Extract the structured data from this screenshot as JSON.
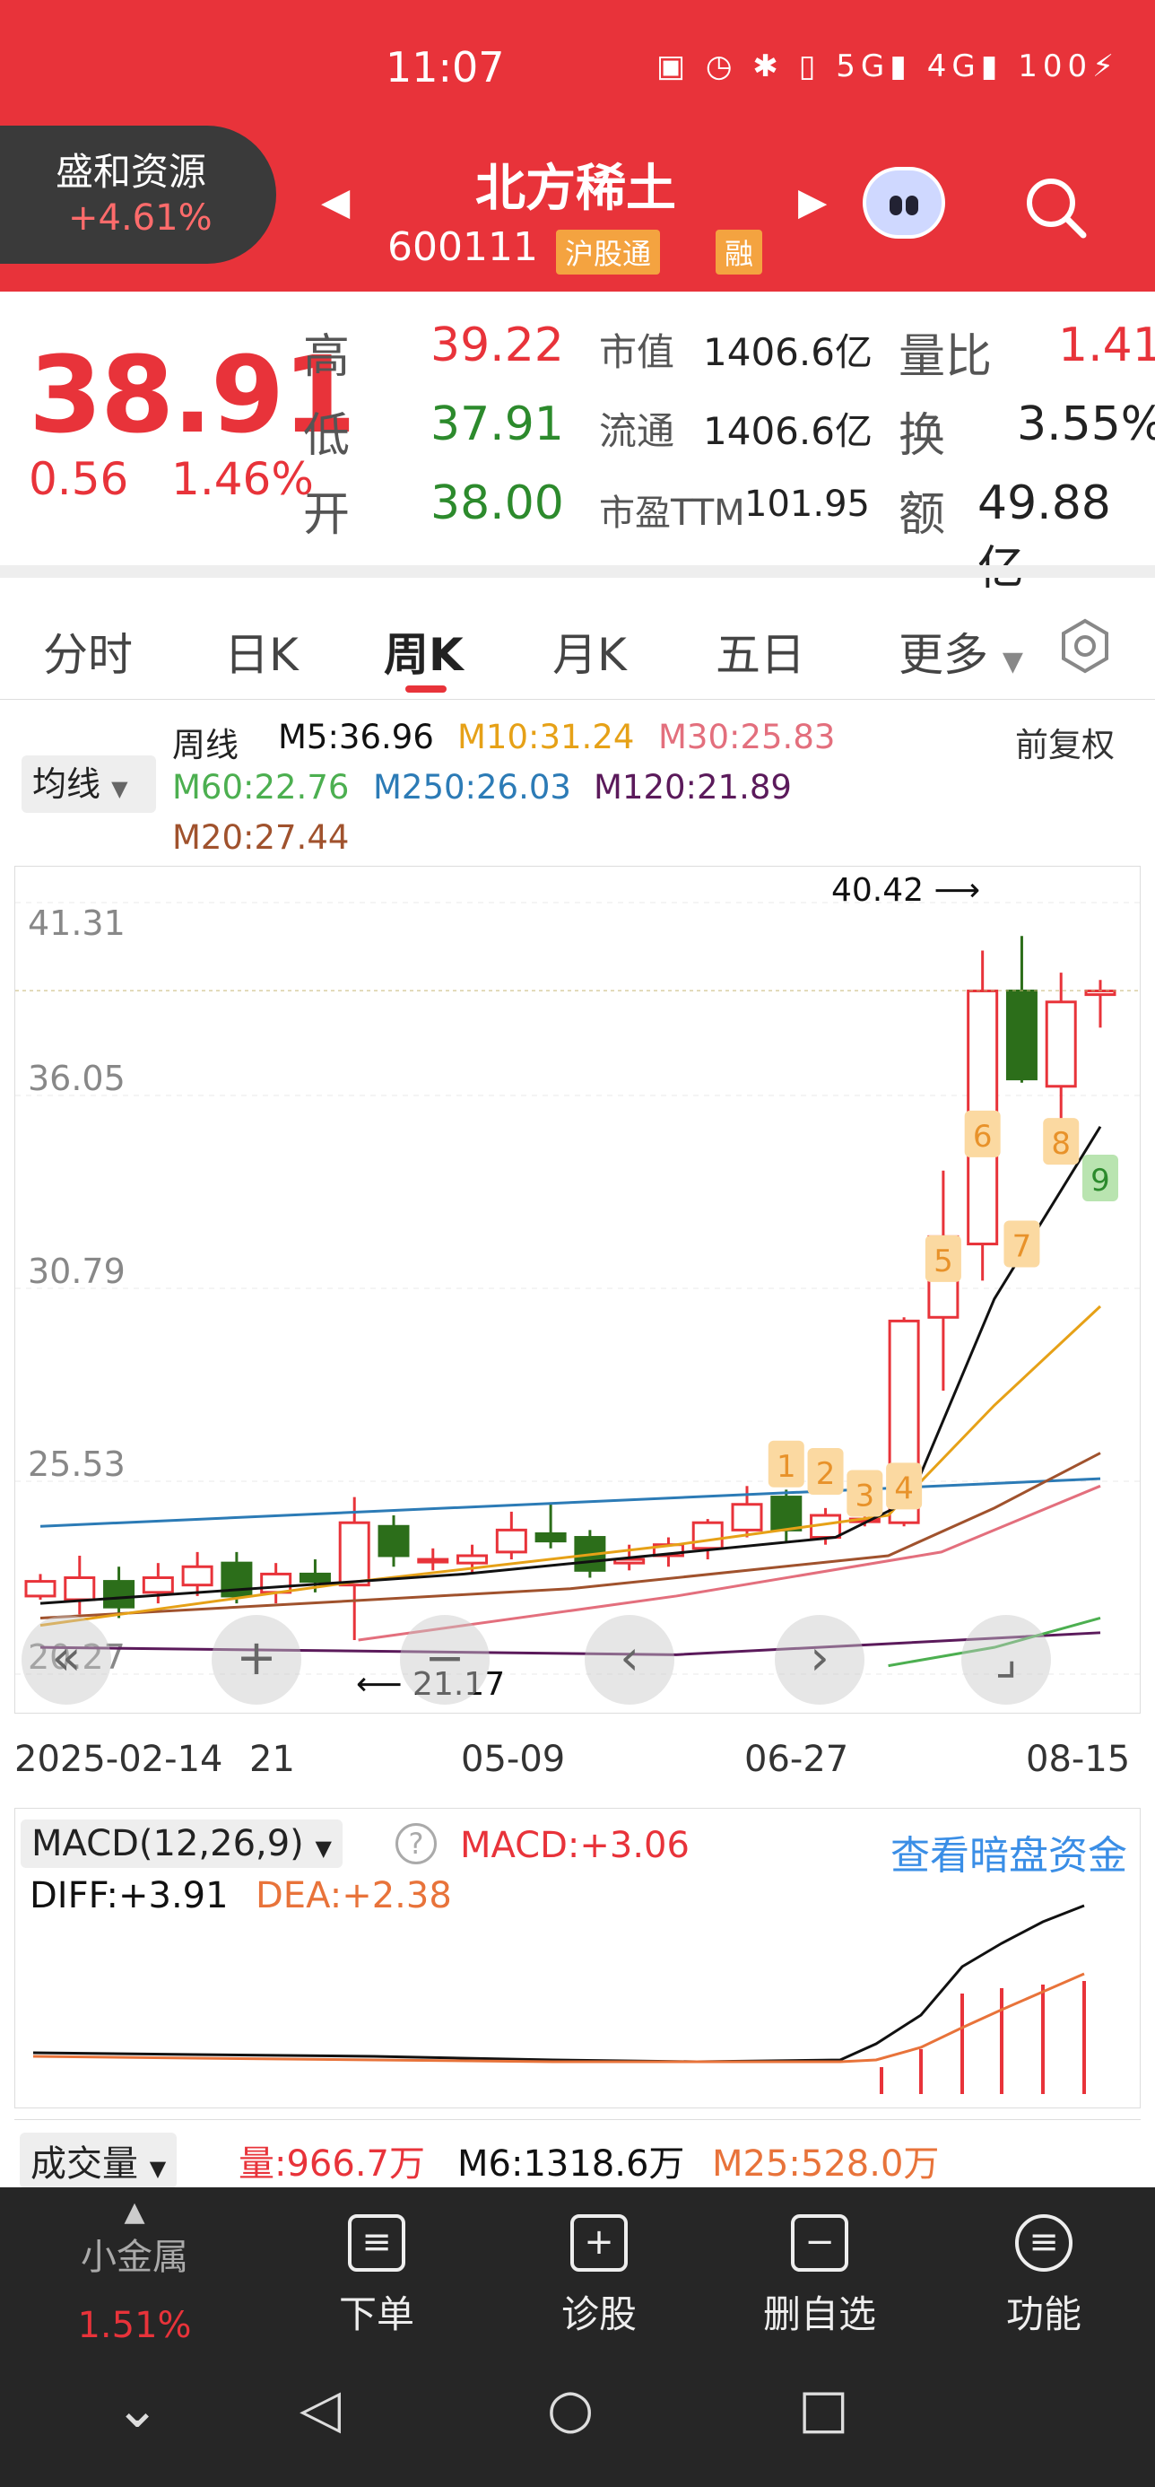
{
  "status": {
    "time": "11:07",
    "battery": "100"
  },
  "header": {
    "peer_name": "盛和资源",
    "peer_change": "+4.61%",
    "stock_name": "北方稀土",
    "stock_code": "600111",
    "tag_connect": "沪股通",
    "tag_margin": "融"
  },
  "quote": {
    "price": "38.91",
    "change": "0.56",
    "change_pct": "1.46%",
    "rows": [
      {
        "k1": "高",
        "v1": "39.22",
        "k2": "市值",
        "v2": "1406.6亿",
        "k3": "量比",
        "v3": "1.41"
      },
      {
        "k1": "低",
        "v1": "37.91",
        "k2": "流通",
        "v2": "1406.6亿",
        "k3": "换",
        "v3": "3.55%"
      },
      {
        "k1": "开",
        "v1": "38.00",
        "k2": "市盈TTM",
        "v2": "101.95",
        "k3": "额",
        "v3": "49.88亿"
      }
    ]
  },
  "tabs": [
    "分时",
    "日K",
    "周K",
    "月K",
    "五日",
    "更多"
  ],
  "ma": {
    "period": "周线",
    "dropdown": "均线",
    "right": "前复权",
    "m5": "M5:36.96",
    "m10": "M10:31.24",
    "m30": "M30:25.83",
    "m60": "M60:22.76",
    "m250": "M250:26.03",
    "m120": "M120:21.89",
    "m20": "M20:27.44"
  },
  "colors": {
    "red": "#e8333a",
    "green": "#2c6e1a",
    "m5": "#111111",
    "m10": "#e6a117",
    "m30": "#e36f7d",
    "m60": "#4caf50",
    "m250": "#2c7bb6",
    "m120": "#5b1a5b",
    "m20": "#a0522d"
  },
  "chart_data": {
    "type": "candlestick",
    "y_ticks": [
      "41.31",
      "36.05",
      "30.79",
      "25.53",
      "20.27"
    ],
    "ylim": [
      20.27,
      41.31
    ],
    "x_ticks": [
      "2025-02-14",
      "21",
      "05-09",
      "06-27",
      "08-15"
    ],
    "high_label": "40.42",
    "low_label": "21.17",
    "seq_labels": [
      "1",
      "2",
      "3",
      "4",
      "5",
      "6",
      "7",
      "8",
      "9"
    ],
    "candles": [
      [
        22.4,
        22.8,
        23.0,
        22.3
      ],
      [
        22.3,
        22.9,
        23.5,
        21.9
      ],
      [
        22.8,
        22.1,
        23.2,
        21.8
      ],
      [
        22.5,
        22.9,
        23.3,
        22.2
      ],
      [
        22.7,
        23.2,
        23.6,
        22.4
      ],
      [
        23.3,
        22.4,
        23.6,
        22.2
      ],
      [
        22.5,
        23.0,
        23.3,
        22.2
      ],
      [
        23.0,
        22.8,
        23.4,
        22.5
      ],
      [
        22.7,
        24.4,
        25.1,
        21.2
      ],
      [
        24.3,
        23.5,
        24.6,
        23.2
      ],
      [
        23.4,
        23.4,
        23.7,
        23.1
      ],
      [
        23.3,
        23.5,
        23.8,
        23.0
      ],
      [
        23.6,
        24.2,
        24.7,
        23.4
      ],
      [
        24.1,
        23.9,
        24.9,
        23.7
      ],
      [
        24.0,
        23.1,
        24.2,
        22.9
      ],
      [
        23.3,
        23.4,
        23.8,
        23.1
      ],
      [
        23.5,
        23.8,
        24.0,
        23.2
      ],
      [
        23.7,
        24.4,
        24.5,
        23.4
      ],
      [
        24.2,
        24.9,
        25.4,
        24.0
      ],
      [
        25.1,
        24.2,
        25.3,
        23.9
      ],
      [
        24.0,
        24.6,
        24.8,
        23.8
      ],
      [
        24.5,
        24.5,
        25.3,
        24.3
      ],
      [
        24.4,
        29.9,
        30.0,
        24.3
      ],
      [
        30.0,
        32.2,
        34.0,
        28.0
      ],
      [
        32.0,
        38.9,
        40.0,
        31.0
      ],
      [
        38.9,
        36.5,
        40.4,
        36.4
      ],
      [
        36.3,
        38.6,
        39.4,
        35.0
      ],
      [
        38.8,
        38.9,
        39.2,
        37.9
      ]
    ]
  },
  "macd": {
    "label": "MACD(12,26,9)",
    "macd": "MACD:+3.06",
    "link": "查看暗盘资金",
    "diff": "DIFF:+3.91",
    "dea": "DEA:+2.38"
  },
  "volume": {
    "label": "成交量",
    "vol": "量:966.7万",
    "m6": "M6:1318.6万",
    "m25": "M25:528.0万"
  },
  "bottom": {
    "sector": "小金属",
    "sector_pct": "1.51%",
    "items": [
      "下单",
      "诊股",
      "删自选",
      "功能"
    ]
  }
}
